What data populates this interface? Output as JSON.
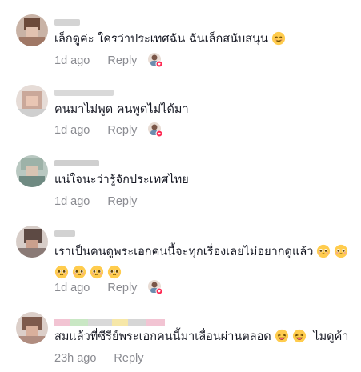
{
  "comments": [
    {
      "text": "เล็กดูค่ะ ใครว่าประเทศฉัน ฉันเล็กสนับสนุน",
      "emojis": [
        "smirk"
      ],
      "time": "1d ago",
      "reply": "Reply",
      "liked_by_author": true
    },
    {
      "text": "คนมาไม่พูด คนพูดไม่ได้มา",
      "emojis": [],
      "time": "1d ago",
      "reply": "Reply",
      "liked_by_author": true
    },
    {
      "text": "แน่ใจนะว่ารู้จักประเทศไทย",
      "emojis": [],
      "time": "1d ago",
      "reply": "Reply",
      "liked_by_author": false
    },
    {
      "text": "เราเป็นคนดูพระเอกคนนี้จะทุกเรื่องเลยไม่อยากดูแล้ว",
      "emojis": [
        "pleading",
        "pleading",
        "pleading",
        "pleading",
        "pleading",
        "pleading"
      ],
      "time": "1d ago",
      "reply": "Reply",
      "liked_by_author": true
    },
    {
      "text": "สมแล้วที่ซีรีย์พระเอกคนนี้มาเลื่อนผ่านตลอด",
      "emojis": [
        "laugh",
        "laugh"
      ],
      "text_suffix": "ไมดูค้า",
      "time": "23h ago",
      "reply": "Reply",
      "liked_by_author": false
    }
  ],
  "colors": {
    "text": "#161823",
    "meta": "#8a8b91",
    "like_badge": "#fe2c55"
  },
  "icons": {
    "emoji_smirk": "smirk-emoji-icon",
    "emoji_pleading": "pleading-face-emoji-icon",
    "emoji_laugh": "laughing-emoji-icon",
    "liked_by_creator": "creator-liked-icon"
  }
}
